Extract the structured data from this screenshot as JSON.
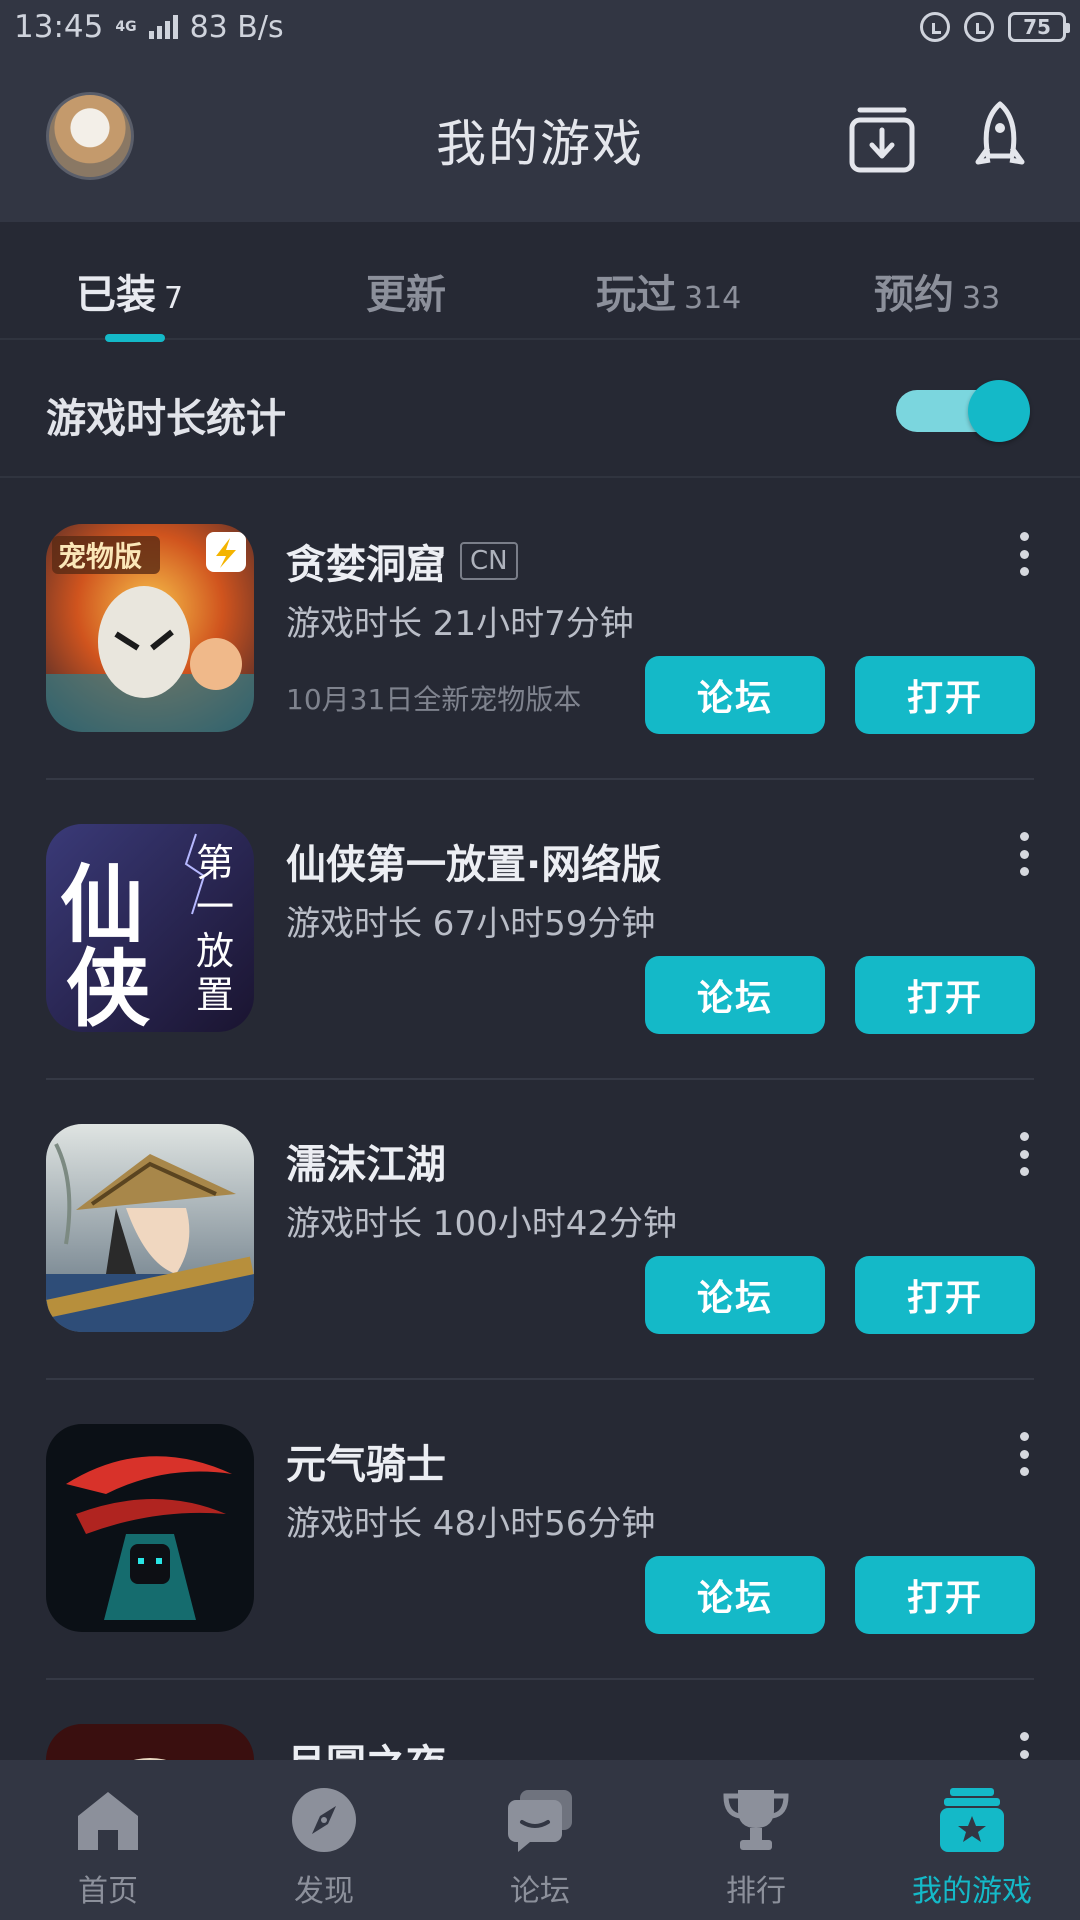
{
  "status_bar": {
    "time": "13:45",
    "network_type": "4G",
    "speed": "83 B/s",
    "battery": "75"
  },
  "header": {
    "title": "我的游戏",
    "download_icon": "download-box-icon",
    "rocket_icon": "rocket-icon"
  },
  "tabs": [
    {
      "label": "已装",
      "count": "7",
      "active": true
    },
    {
      "label": "更新",
      "count": "",
      "active": false
    },
    {
      "label": "玩过",
      "count": "314",
      "active": false
    },
    {
      "label": "预约",
      "count": "33",
      "active": false
    }
  ],
  "stats": {
    "label": "游戏时长统计",
    "toggle_on": true
  },
  "games": [
    {
      "name": "贪婪洞窟",
      "tag": "CN",
      "time": "游戏时长 21小时7分钟",
      "note": "10月31日全新宠物版本",
      "forum": "论坛",
      "open": "打开"
    },
    {
      "name": "仙侠第一放置·网络版",
      "tag": "",
      "time": "游戏时长 67小时59分钟",
      "note": "",
      "forum": "论坛",
      "open": "打开"
    },
    {
      "name": "濡沫江湖",
      "tag": "",
      "time": "游戏时长 100小时42分钟",
      "note": "",
      "forum": "论坛",
      "open": "打开"
    },
    {
      "name": "元气骑士",
      "tag": "",
      "time": "游戏时长 48小时56分钟",
      "note": "",
      "forum": "论坛",
      "open": "打开"
    },
    {
      "name": "月圆之夜",
      "tag": "",
      "time": "",
      "note": "",
      "forum": "",
      "open": ""
    }
  ],
  "bottom_nav": [
    {
      "label": "首页",
      "icon": "home-icon",
      "active": false
    },
    {
      "label": "发现",
      "icon": "compass-icon",
      "active": false
    },
    {
      "label": "论坛",
      "icon": "forum-chat-icon",
      "active": false
    },
    {
      "label": "排行",
      "icon": "trophy-icon",
      "active": false
    },
    {
      "label": "我的游戏",
      "icon": "my-games-star-icon",
      "active": true
    }
  ],
  "colors": {
    "accent": "#14b9c8",
    "background": "#262934",
    "header_bg": "#323643"
  }
}
